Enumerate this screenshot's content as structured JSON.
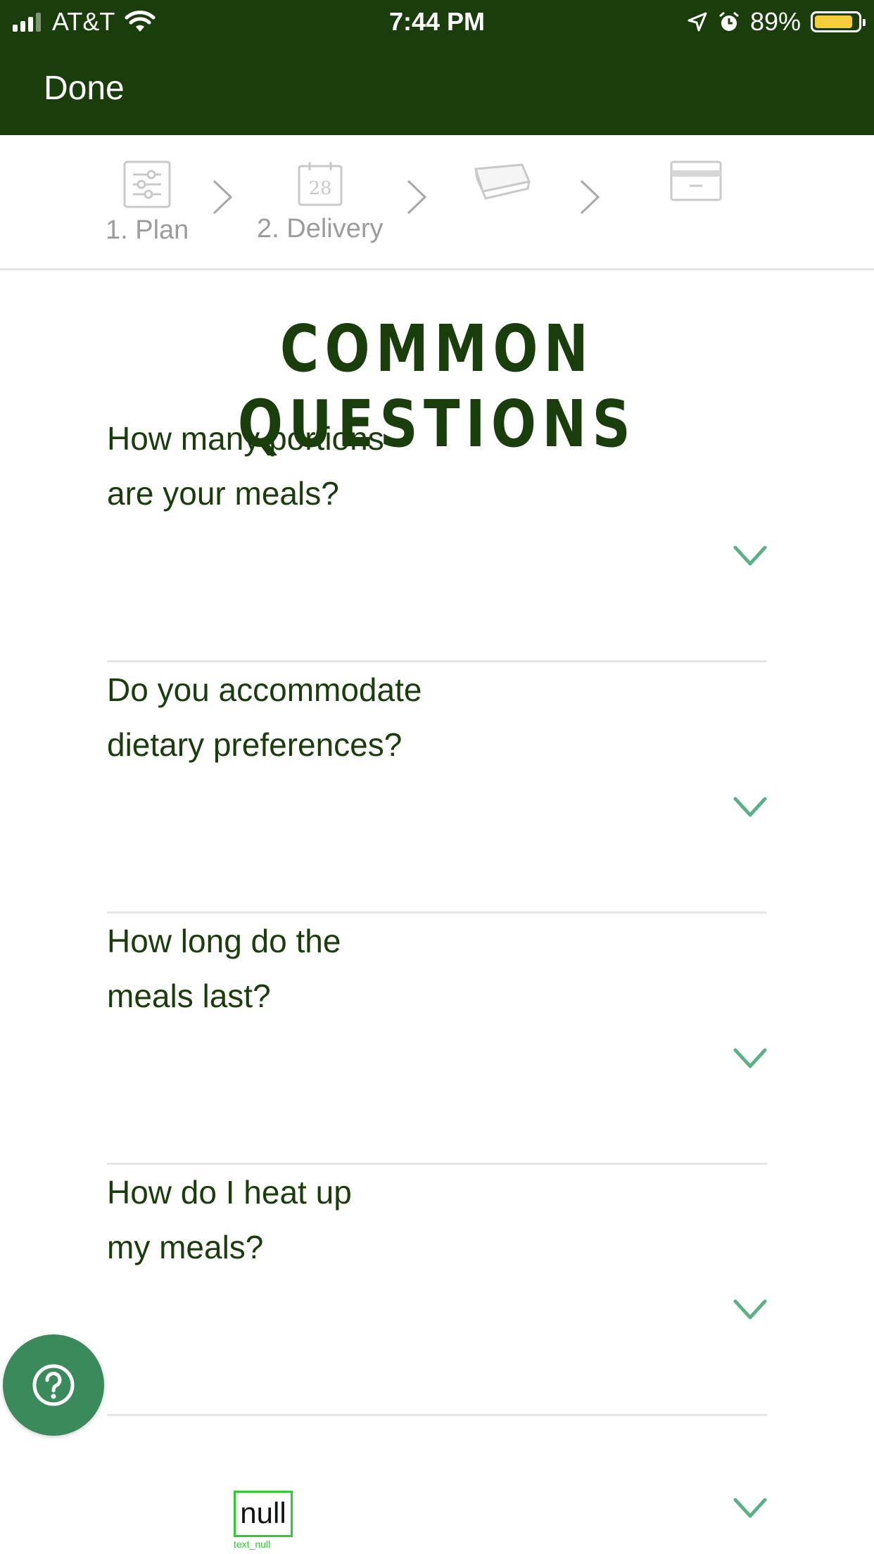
{
  "status_bar": {
    "carrier": "AT&T",
    "time": "7:44 PM",
    "battery_percent": "89%",
    "battery_level": 0.89,
    "battery_color": "#f6cd3a"
  },
  "nav": {
    "done_label": "Done",
    "background_color": "#1a3d0c"
  },
  "stepper": {
    "steps": [
      {
        "label": "1. Plan",
        "icon": "sliders-icon"
      },
      {
        "label": "2. Delivery",
        "icon": "calendar-icon",
        "calendar_day": "28"
      },
      {
        "label": "",
        "icon": "meal-box-icon"
      },
      {
        "label": "",
        "icon": "credit-card-icon"
      }
    ]
  },
  "heading": "COMMON QUESTIONS",
  "faq": [
    {
      "question": "How many portions\nare your meals?"
    },
    {
      "question": "Do you accommodate\ndietary preferences?"
    },
    {
      "question": "How long do the\nmeals last?"
    },
    {
      "question": "How do I heat up\nmy meals?"
    }
  ],
  "overlay": {
    "null_text": "null",
    "null_caption": "text_null"
  },
  "colors": {
    "accent_green": "#3b8a5c",
    "chevron_green": "#5cb088",
    "heading_green": "#1a3d0c"
  },
  "help_button_icon": "question-mark-icon"
}
